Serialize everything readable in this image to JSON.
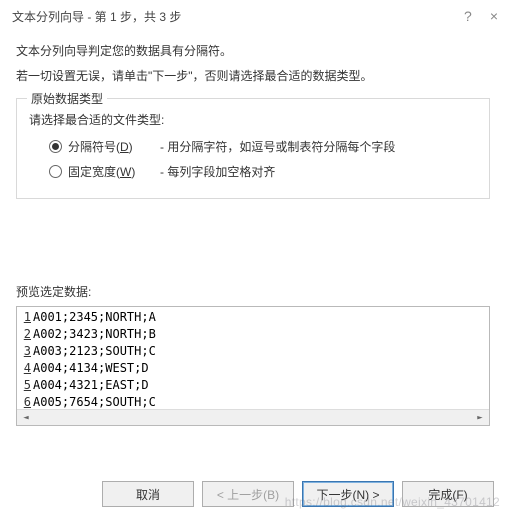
{
  "titlebar": {
    "title": "文本分列向导 - 第 1 步，共 3 步",
    "help_icon": "?",
    "close_icon": "×"
  },
  "intro": {
    "line1": "文本分列向导判定您的数据具有分隔符。",
    "line2": "若一切设置无误，请单击\"下一步\"，否则请选择最合适的数据类型。"
  },
  "groupbox": {
    "legend": "原始数据类型",
    "prompt": "请选择最合适的文件类型:",
    "options": [
      {
        "label_prefix": "分隔符号(",
        "label_u": "D",
        "label_suffix": ")",
        "desc": "- 用分隔字符，如逗号或制表符分隔每个字段",
        "selected": true
      },
      {
        "label_prefix": "固定宽度(",
        "label_u": "W",
        "label_suffix": ")",
        "desc": "- 每列字段加空格对齐",
        "selected": false
      }
    ]
  },
  "preview": {
    "label": "预览选定数据:",
    "rows": [
      {
        "n": "1",
        "text": "A001;2345;NORTH;A"
      },
      {
        "n": "2",
        "text": "A002;3423;NORTH;B"
      },
      {
        "n": "3",
        "text": "A003;2123;SOUTH;C"
      },
      {
        "n": "4",
        "text": "A004;4134;WEST;D"
      },
      {
        "n": "5",
        "text": "A004;4321;EAST;D"
      },
      {
        "n": "6",
        "text": "A005;7654;SOUTH;C"
      }
    ]
  },
  "buttons": {
    "cancel": "取消",
    "back": "< 上一步(B)",
    "next": "下一步(N) >",
    "finish": "完成(F)"
  },
  "watermark": "https://blog.csdn.net/weixin_43701412"
}
